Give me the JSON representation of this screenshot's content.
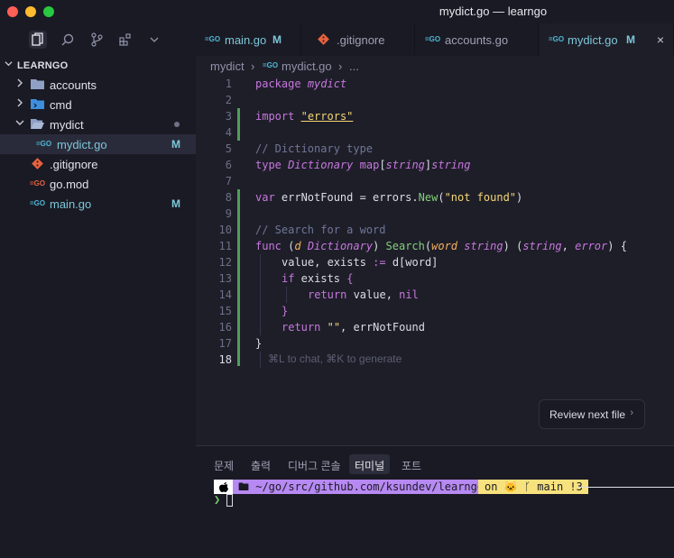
{
  "window": {
    "title": "mydict.go — learngo"
  },
  "activity_bar": {
    "icons": [
      "files-icon",
      "search-icon",
      "source-control-icon",
      "extensions-icon",
      "chevron-down-icon"
    ]
  },
  "explorer": {
    "root_label": "LEARNGO",
    "items": [
      {
        "label": "accounts",
        "kind": "folder"
      },
      {
        "label": "cmd",
        "kind": "folder"
      },
      {
        "label": "mydict",
        "kind": "folder-open"
      },
      {
        "label": "mydict.go",
        "kind": "go",
        "badge": "M"
      },
      {
        "label": ".gitignore",
        "kind": "git"
      },
      {
        "label": "go.mod",
        "kind": "gomod"
      },
      {
        "label": "main.go",
        "kind": "go",
        "badge": "M"
      }
    ]
  },
  "tabs": [
    {
      "label": "main.go",
      "badge": "M",
      "icon_text": "=GO"
    },
    {
      "label": ".gitignore",
      "icon_text": "◆"
    },
    {
      "label": "accounts.go",
      "icon_text": "=GO"
    },
    {
      "label": "mydict.go",
      "badge": "M",
      "icon_text": "=GO",
      "close": "×"
    }
  ],
  "breadcrumb": {
    "folder": "mydict",
    "sep": "›",
    "file": "mydict.go",
    "more": "..."
  },
  "editor": {
    "line_numbers": [
      "1",
      "2",
      "3",
      "4",
      "5",
      "6",
      "7",
      "8",
      "9",
      "10",
      "11",
      "12",
      "13",
      "14",
      "15",
      "16",
      "17",
      "18"
    ],
    "hint": "⌘L to chat, ⌘K to generate",
    "tokens": {
      "l1_kw": "package",
      "l1_pk": "mydict",
      "l3_kw": "import",
      "l3_str": "\"errors\"",
      "l5_cm": "// Dictionary type",
      "l6_kw": "type",
      "l6_ty": "Dictionary",
      "l6_map": "map",
      "l6_b1": "[",
      "l6_t1": "string",
      "l6_b2": "]",
      "l6_t2": "string",
      "l8_kw": "var",
      "l8_a": " errNotFound = errors.",
      "l8_fn": "New",
      "l8_b": "(",
      "l8_str": "\"not found\"",
      "l8_c": ")",
      "l10_cm": "// Search for a word",
      "l11_kw": "func",
      "l11_a": " (",
      "l11_p": "d",
      "l11_sp": " ",
      "l11_ty": "Dictionary",
      "l11_b": ") ",
      "l11_fn": "Search",
      "l11_c": "(",
      "l11_p2": "word",
      "l11_sp2": " ",
      "l11_t2": "string",
      "l11_d": ") (",
      "l11_t3": "string",
      "l11_e": ", ",
      "l11_t4": "error",
      "l11_f": ") {",
      "l12_a": "value, exists ",
      "l12_op": ":=",
      "l12_b": " d[word]",
      "l13_kw": "if",
      "l13_a": " exists ",
      "l13_br": "{",
      "l14_kw": "return",
      "l14_a": " value, ",
      "l14_nil": "nil",
      "l15_br": "}",
      "l16_kw": "return",
      "l16_sp": " ",
      "l16_str": "\"\"",
      "l16_a": ", errNotFound",
      "l17": "}"
    }
  },
  "review_button": {
    "label": "Review next file",
    "chevron": "›"
  },
  "panel": {
    "tabs": [
      "문제",
      "출력",
      "디버그 콘솔",
      "터미널",
      "포트"
    ],
    "active_tab": "터미널",
    "terminal": {
      "apple": "",
      "path": "🖿 ~/go/src/github.com/ksundev/learngo",
      "git": "on 🐱 ᚴ main !3",
      "prompt": "❯"
    }
  },
  "colors": {
    "accent": "#7cc7d9",
    "modified_gutter": "#4f9e5a",
    "terminal_path_bg": "#b789f2",
    "terminal_git_bg": "#f7e27d"
  }
}
